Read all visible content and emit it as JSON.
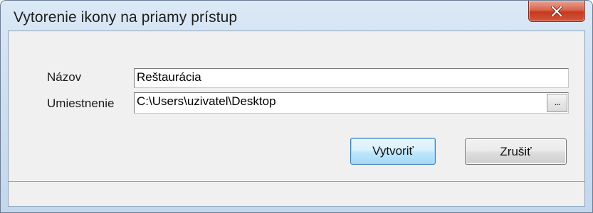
{
  "window": {
    "title": "Vytorenie ikony na priamy prístup",
    "close_icon": "close-icon"
  },
  "form": {
    "name_label": "Názov",
    "name_value": "Reštaurácia",
    "location_label": "Umiestnenie",
    "location_value": "C:\\Users\\uzivatel\\Desktop",
    "browse_label": "..."
  },
  "buttons": {
    "create_label": "Vytvoriť",
    "cancel_label": "Zrušiť"
  },
  "colors": {
    "close_button": "#c4391f",
    "default_button_border": "#3c7fb1",
    "title_bar": "#cfe0f1",
    "client_background": "#f0f0f0"
  }
}
